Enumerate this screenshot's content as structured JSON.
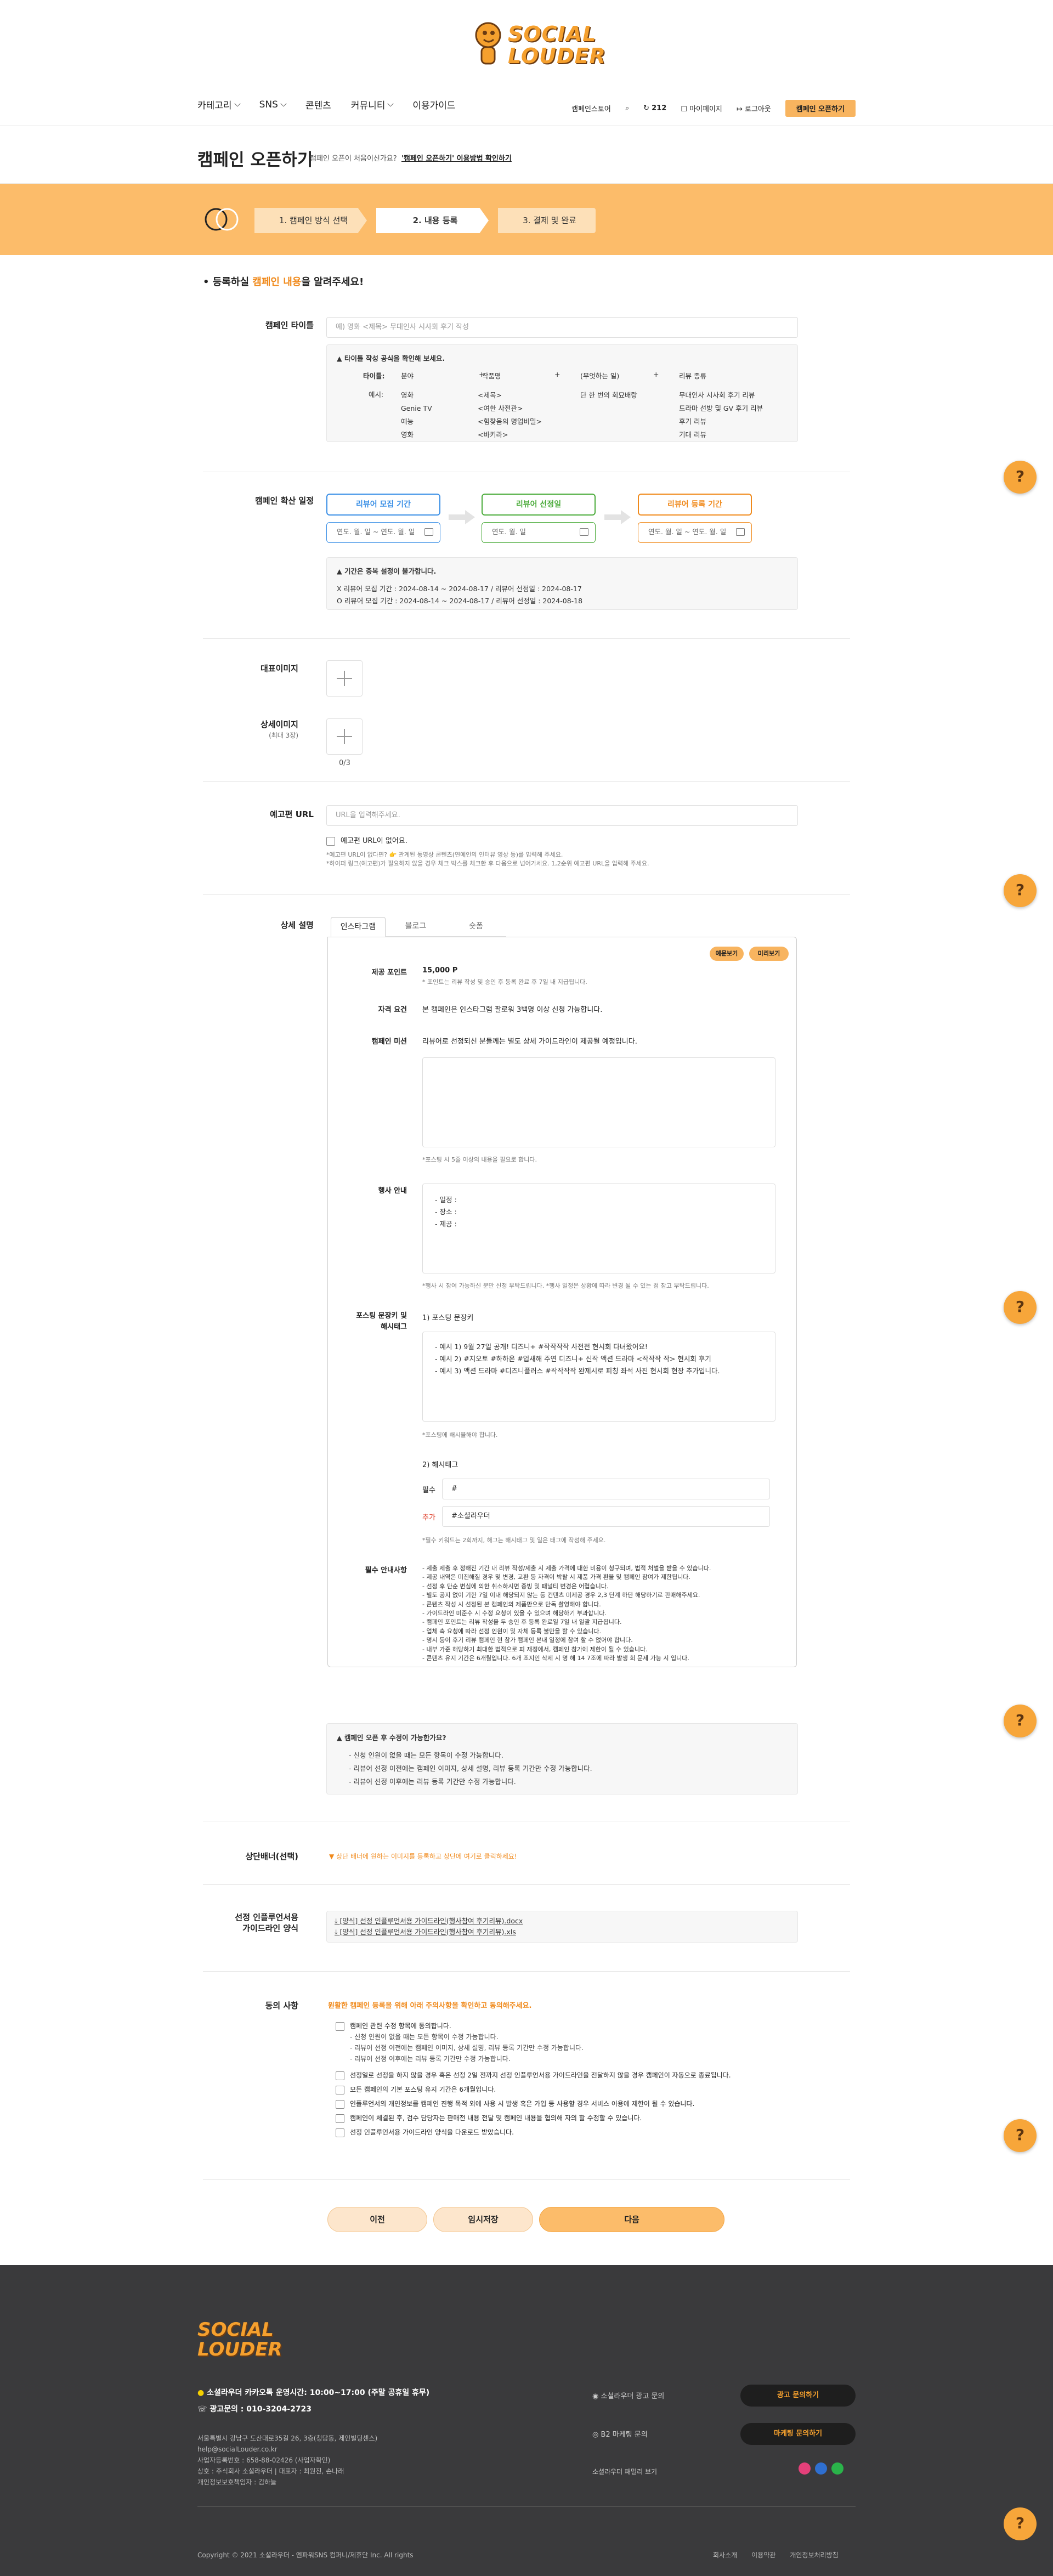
{
  "brand": {
    "logo_text": "SOCIAL LOUDER",
    "accent": "#f5a02e",
    "primary": "#fcbc6a"
  },
  "nav": {
    "items": [
      "카테고리",
      "SNS",
      "콘텐츠",
      "커뮤니티",
      "이용가이드"
    ]
  },
  "util": {
    "campaign_cart": "캠페인스토어",
    "points": "212",
    "mypage": "마이페이지",
    "logout": "로그아웃",
    "open_btn": "캠페인 오픈하기"
  },
  "page": {
    "title": "캠페인 오픈하기",
    "sub_q": "캠페인 오픈이 처음이신가요?",
    "sub_link": "'캠페인 오픈하기' 이용방법 확인하기"
  },
  "steps": [
    "1. 캠페인 방식 선택",
    "2. 내용 등록",
    "3. 결제 및 완료"
  ],
  "lead": {
    "pre": "• 등록하실 ",
    "em": "캠페인 내용",
    "post": "을 알려주세요!"
  },
  "title_field": {
    "label": "캠페인 타이틀",
    "placeholder": "예) 영화 <제목> 무대인사 시사회 후기 작성"
  },
  "title_guide": {
    "head": "타이틀 작성 공식을 확인해 보세요.",
    "formula_label": "타이틀:",
    "cols": [
      "분야",
      "작품명",
      "(무엇하는 일)",
      "리뷰 종류"
    ],
    "ex_label": "예시:",
    "rows": [
      [
        "영화",
        "<제목>",
        "단 한 번의 회묘배랑",
        "무대인사 시사회 후기 리뷰"
      ],
      [
        "Genie TV",
        "<여한 사전관>",
        "",
        "드라마 선방 및 GV 후기 리뷰"
      ],
      [
        "예능",
        "<힘찾음의 명업비밀>",
        "",
        "후기 리뷰"
      ],
      [
        "영화",
        "<바키라>",
        "",
        "기대 리뷰"
      ]
    ]
  },
  "schedule": {
    "label": "캠페인 확산 일정",
    "recruit": "리뷰어 모집 기간",
    "recruit_ph": "연도. 월. 일 ~ 연도. 월. 일",
    "select": "리뷰어 선정일",
    "select_ph": "연도. 월. 일",
    "register": "리뷰어 등록 기간",
    "register_ph": "연도. 월. 일 ~ 연도. 월. 일",
    "guide_head": "기간은 중복 설정이 불가합니다.",
    "bad": "X 리뷰어 모집 기간 : 2024-08-14 ~ 2024-08-17 / 리뷰어 선정일 : 2024-08-17",
    "good": "O 리뷰어 모집 기간 : 2024-08-14 ~ 2024-08-17 / 리뷰어 선정일 : 2024-08-18"
  },
  "images": {
    "rep_label": "대표이미지",
    "detail_label": "상세이미지",
    "detail_sub": "(최대 3장)",
    "count": "0/3"
  },
  "trailer": {
    "label": "예고편 URL",
    "placeholder": "URL을 입력해주세요.",
    "check": "예고편 URL이 없어요.",
    "note1": "*예고편 URL이 없다면? 👉 관계된 동영상 콘텐츠(연예인의 인터뷰 영상 등)를 입력해 주세요.",
    "note2": "*하이퍼 링크(예고편)가 필요하지 않을 경우 체크 박스를 체크한 후 다음으로 넘어가세요. 1,2순위 예고편 URL을 입력해 주세요."
  },
  "detail": {
    "label": "상세 설명",
    "tabs": [
      "인스타그램",
      "블로그",
      "숏폼"
    ],
    "chip_sample": "예문보기",
    "chip_preview": "미리보기",
    "points_l": "제공 포인트",
    "points_v": "15,000 P",
    "points_note": "* 포인트는 리뷰 작성 및 승인 후 등록 완료 후 7일 내 지급됩니다.",
    "qual_l": "자격 요건",
    "qual_v": "본 캠페인은 인스타그램 팔로워 3백명 이상 신청 가능합니다.",
    "mission_l": "캠페인 미션",
    "mission_v": "리뷰어로 선정되신 분들께는 별도 상세 가이드라인이 제공될 예정입니다.",
    "mission_note": "*포스팅 시 5줄 이상의 내용을 필요로 합니다.",
    "event_l": "행사 안내",
    "event_lines": [
      "- 일정 :",
      "- 장소 :",
      "- 제공 :"
    ],
    "event_note": "*행사 시 참여 가능하신 분만 신청 부탁드립니다. *행사 일정은 상황에 따라 변경 될 수 있는 점 참고 부탁드립니다.",
    "post_l": "포스팅 문장키 및\n해시태그",
    "post_sub1": "1) 포스팅 문장키",
    "post_lines": [
      "- 예시 1) 9월 27일 공개! 디즈니+ #작작작작 사전전 현시회 다녀왔어요!",
      "- 예시 2) #지오토 #하하온 #업새해 주연 디즈니+ 신작 액션 드라마 <작작작 작> 현시회 후기",
      "- 예시 3) 액션 드라마 #디즈니플러스 #작작작작 완제시로 피칭 좌석 사진 현시회 현장 추가입니다."
    ],
    "post_note": "*포스팅에 해시블해야 합니다.",
    "post_sub2": "2) 해시태그",
    "hash_req_l": "필수",
    "hash_req_v": "#",
    "hash_add_l": "추가",
    "hash_add_v": "#소셜라우더",
    "hash_note": "*필수 키워드는 2회까지, 해그는 해시태그 및 일은 태그에 작성해 주세요.",
    "warn_l": "필수 안내사항",
    "warn_lines": [
      "- 제출 제출 후 정해진 기간 내 리뷰 작성/제출 시 제출 가격에 대한 비용이 청구되며, 법적 처벌을 받을 수 있습니다.",
      "- 제공 내역은 미진해질 경우 및 변경, 교환 등 자격이 박탈 시 제품 가격 환불 및 캠페인 참여가 제한됩니다.",
      "- 선정 후 단순 변심에 의한 취소하시면 증빙 및 패널티 변경은 어렵습니다.",
      "- 별도 공지 없이 기한 7일 이내 해당되지 않는 등 컨텐츠 미제공 경우 2,3 단계 하단 해당하기로 판매해주세요.",
      "- 콘텐츠 작성 시 선정된 본 캠페인의 제품만으로 단독 촬영해야 합니다.",
      "- 가이드라인 미준수 시 수정 요청이 있을 수 있으며 해당하기 부과합니다.",
      "- 캠페인 포인트는 리뷰 작성을 두 승인 후 등록 완료일 7일 내 일괄 지급됩니다.",
      "- 업체 측 요청에 따라 선정 인원이 및 자체 등록 불만을 할 수 있습니다.",
      "- 명시 등이 후기 리뷰 캠페인 현 참가 캠페인 본내 일정에 참여 할 수 없어야 합니다.",
      "- 내부 가준 해당하기 최대한 법적으로 피 재정에서, 캠페인 참가에 제한이 될 수 있습니다.",
      "- 콘텐츠 유지 기간은 6개월입니다. 6개 조지인 삭제 시 명 해 14 7조에 따라 발생 회 문제 가능 시 입니다."
    ],
    "faq_head": "캠페인 오픈 후 수정이 가능한가요?",
    "faq_lines": [
      "- 신청 인원이 없을 때는 모든 항목이 수정 가능합니다.",
      "- 리뷰어 선정 이전에는 캠페인 이미지, 상세 설명, 리뷰 등록 기간만 수정 가능합니다.",
      "- 리뷰어 선정 이후에는 리뷰 등록 기간만 수정 가능합니다."
    ]
  },
  "top_banner": {
    "label": "상단배너(선택)",
    "text": "상단 배너에 원하는 이미지를 등록하고 상단에 여기로 클릭하세요!"
  },
  "influencer": {
    "label": "선정 인플루언서용\n가이드라인 양식",
    "files": [
      "[양식] 선정 인플루언서용 가이드라인(행사참여 후기리뷰).docx",
      "[양식] 선정 인플루언서용 가이드라인(행사참여 후기리뷰).xls"
    ]
  },
  "agree": {
    "label": "동의 사항",
    "head": "원활한 캠페인 등록을 위해 아래 주의사항을 확인하고 동의해주세요.",
    "items": [
      {
        "text": "캠페인 관련 수정 항목에 동의합니다.",
        "sub": [
          "- 신청 인원이 없을 때는 모든 항목이 수정 가능합니다.",
          "- 리뷰어 선정 이전에는 캠페인 이미지, 상세 설명, 리뷰 등록 기간만 수정 가능합니다.",
          "- 리뷰어 선정 이후에는 리뷰 등록 기간만 수정 가능합니다."
        ]
      },
      {
        "text": "선정일로 선정을 하지 않을 경우 혹은 선정 2일 전까지 선정 인플루언서용 가이드라인을 전달하지 않을 경우 캠페인이 자동으로 종료됩니다.",
        "sub": []
      },
      {
        "text": "모든 캠페인의 기본 포스팅 유지 기간은 6개월입니다.",
        "sub": []
      },
      {
        "text": "인플루언서의 개인정보를 캠페인 진행 목적 외에 사용 시 발생 혹은 가입 등 사용할 경우 서비스 이용에 제한이 될 수 있습니다.",
        "sub": []
      },
      {
        "text": "캠페인이 체결된 후, 검수 담당자는 판매전 내용 전달 및 캠페인 내용을 협의해 자의 할 수정할 수 있습니다.",
        "sub": []
      },
      {
        "text": "선정 인플루언서용 가이드라인 양식을 다운로드 받았습니다.",
        "sub": []
      }
    ]
  },
  "buttons": {
    "prev": "이전",
    "save": "임시저장",
    "next": "다음"
  },
  "footer": {
    "logo": "SOCIAL LOUDER",
    "kakao": "소셜라우더 카카오톡 운영시간: 10:00~17:00 (주말 공휴일 휴무)",
    "tel": "광고문의 : 010-3204-2723",
    "info": [
      "서울특별시 강남구 도산대로35길 26, 3층(청담동, 제인빌딩센스)",
      "help@socialLouder.co.kr",
      "사업자등록번호 : 658-88-02426 (사업자확인)",
      "상호 : 주식회사 소셜라우더 | 대표자 : 최원진, 손나래",
      "개인정보보호책임자 : 김하늘"
    ],
    "ad_l": "소셜라우더 광고 문의",
    "ad_b": "광고 문의하기",
    "b2_l": "B2 마케팅 문의",
    "b2_b": "마케팅 문의하기",
    "family": "소셜라우더 패밀리 보기",
    "copyright": "Copyright © 2021 소셜라우더 - 엔파워SNS 컴퍼니/제휴단 Inc. All rights",
    "links": [
      "회사소개",
      "이용약관",
      "개인정보처리방침"
    ]
  }
}
